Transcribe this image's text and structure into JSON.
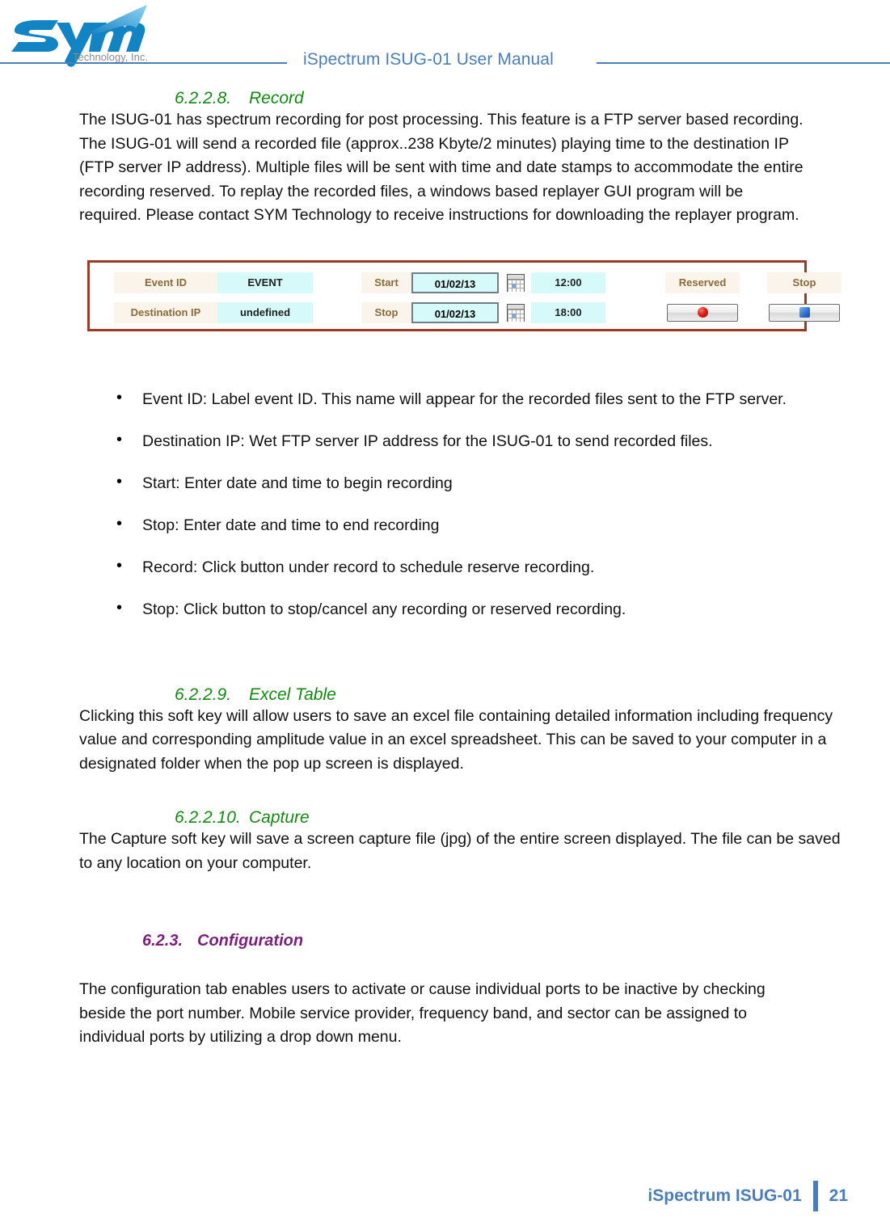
{
  "header": {
    "title": "iSpectrum ISUG-01 User Manual",
    "logo_name": "sym",
    "logo_tagline": "Technology, Inc."
  },
  "sections": {
    "record": {
      "number": "6.2.2.8.",
      "title": "Record",
      "paragraph": "The ISUG-01 has spectrum recording for post processing. This feature is a FTP server based recording. The ISUG-01 will send a recorded file (approx..238 Kbyte/2 minutes) playing time to the destination IP (FTP server IP address). Multiple files will be sent with time and date stamps to accommodate the entire recording reserved. To replay the recorded files, a windows based replayer GUI program will be required. Please contact SYM Technology to receive instructions for downloading the replayer program."
    },
    "excel_table": {
      "number": "6.2.2.9.",
      "title": "Excel Table",
      "paragraph": "Clicking this soft key will allow users to save an excel file containing detailed information including frequency value and corresponding amplitude value in an excel spreadsheet. This can be saved to your computer in a designated folder when the pop up screen is displayed."
    },
    "capture": {
      "number": "6.2.2.10.",
      "title": "Capture",
      "paragraph": "The Capture soft key will save a screen capture file (jpg) of the entire screen displayed. The file can be saved to any location on your computer."
    },
    "configuration": {
      "number": "6.2.3.",
      "title": "Configuration",
      "paragraph": "The configuration tab enables users to activate or cause individual ports to be inactive by checking beside the port number. Mobile service provider, frequency band, and sector can be assigned to individual ports by utilizing a drop down menu."
    }
  },
  "bullets": [
    "Event ID: Label event ID. This name will appear for the recorded files sent to the FTP server.",
    "Destination IP: Wet FTP server IP address for the ISUG-01 to send recorded files.",
    "Start: Enter date and time to begin recording",
    "Stop:  Enter date and time to end recording",
    "Record: Click button under record to schedule reserve recording.",
    "Stop: Click button to stop/cancel any recording or reserved recording."
  ],
  "record_panel": {
    "border_color": "#9c3a26",
    "label_bg": "#faf4ea",
    "label_color": "#8a6a3a",
    "value_bg": "#d6fafa",
    "row1": {
      "label": "Event ID",
      "value": "EVENT",
      "time_label": "Start",
      "date": "01/02/13",
      "calendar_icon": "calendar-icon",
      "time": "12:00",
      "action_label": "Reserved",
      "stop_label": "Stop"
    },
    "row2": {
      "label": "Destination IP",
      "value": "undefined",
      "time_label": "Stop",
      "date": "01/02/13",
      "calendar_icon": "calendar-icon",
      "time": "18:00",
      "record_button_icon": "record-circle-icon",
      "stop_button_icon": "stop-square-icon"
    }
  },
  "footer": {
    "title": "iSpectrum ISUG-01",
    "page_number": "21",
    "accent_color": "#4a7ebb"
  }
}
